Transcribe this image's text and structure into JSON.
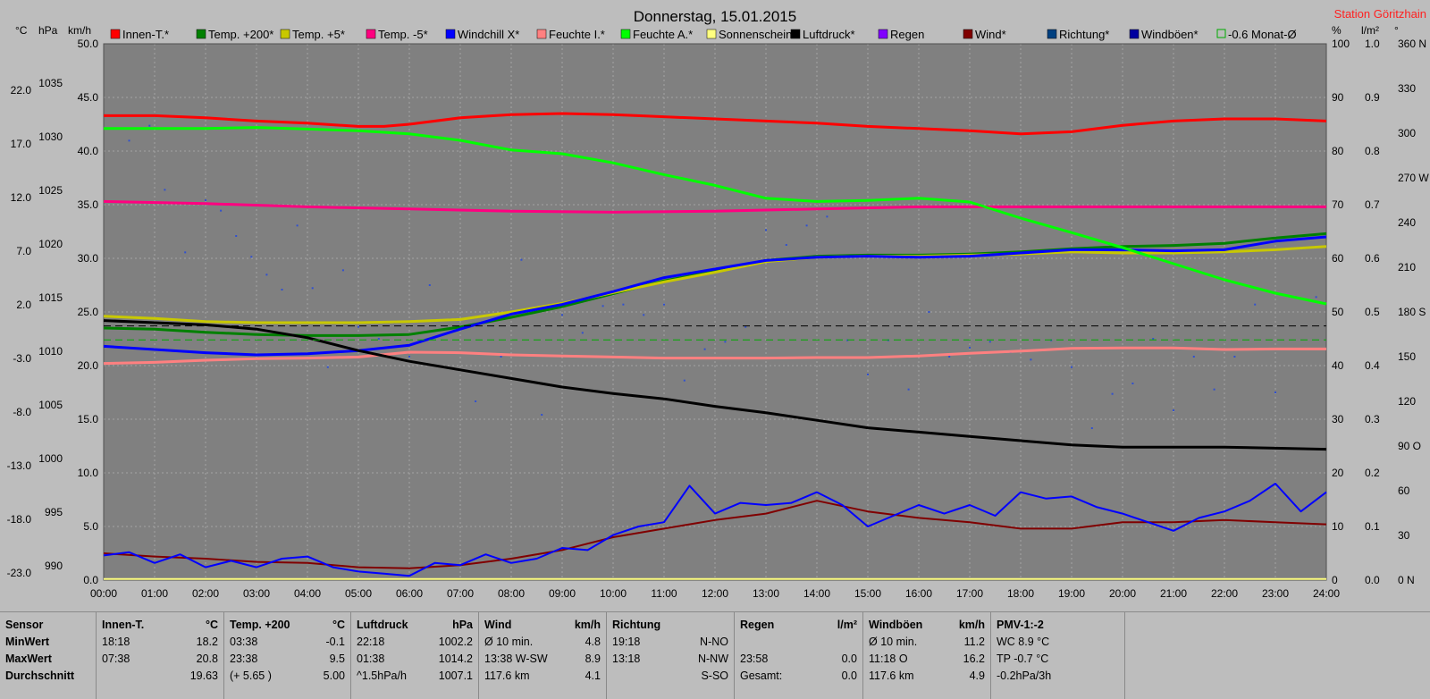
{
  "chart_data": {
    "type": "line",
    "title": "Donnerstag, 15.01.2015",
    "station": "Station Göritzhain",
    "left_axes": [
      {
        "unit": "°C",
        "ticks": [
          "22.0",
          "17.0",
          "12.0",
          "7.0",
          "2.0",
          "-3.0",
          "-8.0",
          "-13.0",
          "-18.0",
          "-23.0"
        ]
      },
      {
        "unit": "hPa",
        "ticks": [
          "1035",
          "1030",
          "1025",
          "1020",
          "1015",
          "1010",
          "1005",
          "1000",
          "995",
          "990"
        ]
      },
      {
        "unit": "km/h",
        "ticks": [
          "50.0",
          "45.0",
          "40.0",
          "35.0",
          "30.0",
          "25.0",
          "20.0",
          "15.0",
          "10.0",
          "5.0",
          "0.0"
        ]
      }
    ],
    "right_axes": [
      {
        "unit": "%",
        "ticks": [
          "100",
          "90",
          "80",
          "70",
          "60",
          "50",
          "40",
          "30",
          "20",
          "10",
          "0"
        ]
      },
      {
        "unit": "l/m²",
        "ticks": [
          "1.0",
          "0.9",
          "0.8",
          "0.7",
          "0.6",
          "0.5",
          "0.4",
          "0.3",
          "0.2",
          "0.1",
          "0.0"
        ]
      },
      {
        "unit": "°",
        "ticks": [
          "360 N",
          "330",
          "300",
          "270 W",
          "240",
          "210",
          "180 S",
          "150",
          "120",
          "90 O",
          "60",
          "30",
          "0 N"
        ]
      }
    ],
    "x_ticks": [
      "00:00",
      "01:00",
      "02:00",
      "03:00",
      "04:00",
      "05:00",
      "06:00",
      "07:00",
      "08:00",
      "09:00",
      "10:00",
      "11:00",
      "12:00",
      "13:00",
      "14:00",
      "15:00",
      "16:00",
      "17:00",
      "18:00",
      "19:00",
      "20:00",
      "21:00",
      "22:00",
      "23:00",
      "24:00"
    ],
    "legend": [
      {
        "name": "Innen-T.*",
        "color": "#ff0000"
      },
      {
        "name": "Temp. +200*",
        "color": "#008000"
      },
      {
        "name": "Temp. +5*",
        "color": "#c8c800"
      },
      {
        "name": "Temp. -5*",
        "color": "#ff0080"
      },
      {
        "name": "Windchill X*",
        "color": "#0000ff"
      },
      {
        "name": "Feuchte I.*",
        "color": "#ff8080"
      },
      {
        "name": "Feuchte A.*",
        "color": "#00ff00"
      },
      {
        "name": "Sonnenschein",
        "color": "#ffff80"
      },
      {
        "name": "Luftdruck*",
        "color": "#000000"
      },
      {
        "name": "Regen",
        "color": "#8000ff"
      },
      {
        "name": "Wind*",
        "color": "#800000"
      },
      {
        "name": "Richtung*",
        "color": "#004080"
      },
      {
        "name": "Windböen*",
        "color": "#0000a0"
      },
      {
        "name": "-0.6 Monat-Ø",
        "color": "#00aa00"
      }
    ],
    "series": [
      {
        "name": "Innen-T.*",
        "axis": "temp",
        "color": "#ff0000",
        "x": [
          0,
          1,
          2,
          3,
          4,
          5,
          5.5,
          6,
          7,
          8,
          9,
          10,
          11,
          12,
          13,
          14,
          15,
          16,
          17,
          18,
          19,
          20,
          21,
          22,
          23,
          24
        ],
        "y": [
          20.3,
          20.3,
          20.1,
          19.8,
          19.6,
          19.3,
          19.3,
          19.5,
          20.1,
          20.4,
          20.5,
          20.4,
          20.2,
          20.0,
          19.8,
          19.6,
          19.3,
          19.1,
          18.9,
          18.6,
          18.8,
          19.4,
          19.8,
          20.0,
          20.0,
          19.8
        ]
      },
      {
        "name": "Temp. +200*",
        "axis": "temp",
        "color": "#008000",
        "x": [
          0,
          1,
          2,
          3,
          4,
          5,
          6,
          7,
          8,
          9,
          10,
          11,
          12,
          13,
          14,
          15,
          16,
          17,
          18,
          19,
          20,
          21,
          22,
          23,
          24
        ],
        "y": [
          0.5,
          0.4,
          0.1,
          -0.1,
          -0.2,
          -0.2,
          -0.1,
          0.6,
          1.5,
          2.5,
          3.7,
          4.9,
          5.8,
          6.8,
          7.2,
          7.3,
          7.3,
          7.4,
          7.6,
          7.9,
          8.1,
          8.2,
          8.4,
          8.9,
          9.3
        ]
      },
      {
        "name": "Temp. +5*",
        "axis": "temp",
        "color": "#c8c800",
        "x": [
          0,
          1,
          2,
          3,
          4,
          5,
          6,
          7,
          8,
          9,
          10,
          11,
          12,
          13,
          14,
          15,
          16,
          17,
          18,
          19,
          20,
          21,
          22,
          23,
          24
        ],
        "y": [
          1.6,
          1.4,
          1.1,
          1.0,
          1.0,
          1.0,
          1.1,
          1.3,
          2.0,
          2.8,
          3.8,
          4.8,
          5.7,
          6.7,
          7.1,
          7.2,
          7.2,
          7.3,
          7.4,
          7.6,
          7.5,
          7.5,
          7.6,
          7.8,
          8.1
        ]
      },
      {
        "name": "Temp. -5*",
        "axis": "temp",
        "color": "#ff0080",
        "x": [
          0,
          2,
          4,
          6,
          8,
          10,
          12,
          14,
          16,
          18,
          20,
          22,
          24
        ],
        "y": [
          12.3,
          12.1,
          11.8,
          11.6,
          11.4,
          11.3,
          11.4,
          11.6,
          11.8,
          11.8,
          11.8,
          11.8,
          11.8
        ]
      },
      {
        "name": "Windchill X*",
        "axis": "temp",
        "color": "#0000ff",
        "x": [
          0,
          1,
          2,
          3,
          4,
          5,
          6,
          7,
          8,
          9,
          10,
          11,
          12,
          13,
          14,
          15,
          16,
          17,
          18,
          19,
          20,
          21,
          22,
          23,
          24
        ],
        "y": [
          -1.2,
          -1.5,
          -1.8,
          -2.0,
          -1.9,
          -1.6,
          -1.1,
          0.4,
          1.8,
          2.7,
          3.9,
          5.2,
          6.0,
          6.8,
          7.1,
          7.2,
          7.1,
          7.2,
          7.5,
          7.8,
          7.8,
          7.7,
          7.8,
          8.6,
          9.0
        ]
      },
      {
        "name": "Feuchte A.*",
        "axis": "pct",
        "color": "#00ff00",
        "x": [
          0,
          1,
          2,
          3,
          4,
          5,
          6,
          7,
          8,
          9,
          10,
          11,
          12,
          13,
          14,
          15,
          16,
          17,
          18,
          19,
          20,
          21,
          22,
          23,
          24
        ],
        "y": [
          84.2,
          84.2,
          84.2,
          84.4,
          84.1,
          83.8,
          83.2,
          82.0,
          80.2,
          79.5,
          77.8,
          75.6,
          73.6,
          71.2,
          70.6,
          70.8,
          71.2,
          70.5,
          67.5,
          64.8,
          62.0,
          59.0,
          56.0,
          53.5,
          51.5
        ]
      },
      {
        "name": "Feuchte I.*",
        "axis": "pct",
        "color": "#ff8080",
        "x": [
          0,
          1,
          2,
          3,
          4,
          5,
          6,
          7,
          8,
          9,
          10,
          11,
          12,
          13,
          14,
          15,
          16,
          17,
          18,
          19,
          20,
          21,
          22,
          23,
          24
        ],
        "y": [
          40.4,
          40.6,
          41.0,
          41.3,
          41.4,
          41.6,
          42.5,
          42.4,
          42.0,
          41.8,
          41.6,
          41.4,
          41.4,
          41.4,
          41.5,
          41.5,
          41.8,
          42.3,
          42.7,
          43.2,
          43.3,
          43.3,
          43.0,
          43.1,
          43.1
        ]
      },
      {
        "name": "Luftdruck*",
        "axis": "hpa",
        "color": "#000000",
        "x": [
          0,
          1,
          2,
          3,
          4,
          5,
          6,
          7,
          8,
          9,
          10,
          11,
          12,
          13,
          14,
          15,
          16,
          17,
          18,
          19,
          20,
          21,
          22,
          23,
          24
        ],
        "y": [
          1014.2,
          1014.0,
          1013.8,
          1013.4,
          1012.6,
          1011.4,
          1010.4,
          1009.6,
          1008.8,
          1008.0,
          1007.4,
          1006.9,
          1006.2,
          1005.6,
          1004.9,
          1004.2,
          1003.8,
          1003.4,
          1003.0,
          1002.6,
          1002.4,
          1002.4,
          1002.4,
          1002.3,
          1002.2
        ]
      },
      {
        "name": "Wind*",
        "axis": "kmh",
        "color": "#800000",
        "x": [
          0,
          1,
          2,
          3,
          4,
          5,
          6,
          7,
          8,
          9,
          10,
          11,
          12,
          13,
          14,
          15,
          16,
          17,
          18,
          19,
          20,
          21,
          22,
          23,
          24
        ],
        "y": [
          2.5,
          2.2,
          2.0,
          1.7,
          1.6,
          1.2,
          1.1,
          1.4,
          2.0,
          2.8,
          4.0,
          4.8,
          5.6,
          6.2,
          7.4,
          6.4,
          5.8,
          5.4,
          4.8,
          4.8,
          5.4,
          5.4,
          5.6,
          5.4,
          5.2
        ]
      },
      {
        "name": "Windböen*",
        "axis": "kmh",
        "color": "#0000ff",
        "x": [
          0,
          0.5,
          1,
          1.5,
          2,
          2.5,
          3,
          3.5,
          4,
          4.5,
          5,
          5.5,
          6,
          6.5,
          7,
          7.5,
          8,
          8.5,
          9,
          9.5,
          10,
          10.5,
          11,
          11.5,
          12,
          12.5,
          13,
          13.5,
          14,
          14.5,
          15,
          15.5,
          16,
          16.5,
          17,
          17.5,
          18,
          18.5,
          19,
          19.5,
          20,
          20.5,
          21,
          21.5,
          22,
          22.5,
          23,
          23.5,
          24
        ],
        "y": [
          2.3,
          2.6,
          1.6,
          2.4,
          1.2,
          1.8,
          1.2,
          2.0,
          2.2,
          1.2,
          0.8,
          0.6,
          0.4,
          1.6,
          1.4,
          2.4,
          1.6,
          2.0,
          3.0,
          2.8,
          4.2,
          5.0,
          5.4,
          8.8,
          6.2,
          7.2,
          7.0,
          7.2,
          8.2,
          7.0,
          5.0,
          6.0,
          7.0,
          6.2,
          7.0,
          6.0,
          8.2,
          7.6,
          7.8,
          6.8,
          6.2,
          5.4,
          4.6,
          5.8,
          6.4,
          7.4,
          9.0,
          6.4,
          8.2
        ]
      },
      {
        "name": "Sonnenschein",
        "axis": "kmh",
        "color": "#ffff80",
        "x": [
          0,
          24
        ],
        "y": [
          0.1,
          0.1
        ]
      },
      {
        "name": "-0.6 Monat-Ø",
        "axis": "temp",
        "color": "#00aa00",
        "dashed": true,
        "x": [
          0,
          24
        ],
        "y": [
          -0.6,
          -0.6
        ]
      },
      {
        "name": "ref",
        "axis": "temp",
        "color": "#000000",
        "dashed": true,
        "x": [
          0,
          24
        ],
        "y": [
          0.7,
          0.7
        ]
      }
    ],
    "direction_points": {
      "axis": "deg",
      "x": [
        0.5,
        0.9,
        1.2,
        1.6,
        2.0,
        2.3,
        2.6,
        2.9,
        3.2,
        3.5,
        3.8,
        4.1,
        4.4,
        4.7,
        5.0,
        5.4,
        5.7,
        6.0,
        6.4,
        6.8,
        7.3,
        7.8,
        8.2,
        8.6,
        9.0,
        9.4,
        9.8,
        10.2,
        10.6,
        11.0,
        11.4,
        11.8,
        12.2,
        12.6,
        13.0,
        13.4,
        13.8,
        14.2,
        14.6,
        15.0,
        15.4,
        15.8,
        16.2,
        16.6,
        17.0,
        17.4,
        17.8,
        18.2,
        18.6,
        19.0,
        19.4,
        19.8,
        20.2,
        20.6,
        21.0,
        21.4,
        21.8,
        22.2,
        22.6,
        23.0,
        23.4,
        23.8
      ],
      "y": [
        295,
        305,
        262,
        220,
        255,
        248,
        231,
        217,
        205,
        195,
        238,
        196,
        143,
        208,
        170,
        162,
        173,
        150,
        198,
        175,
        120,
        150,
        215,
        111,
        178,
        166,
        184,
        185,
        178,
        185,
        134,
        155,
        160,
        170,
        235,
        225,
        238,
        244,
        161,
        138,
        161,
        128,
        180,
        150,
        156,
        160,
        153,
        148,
        161,
        143,
        102,
        125,
        132,
        162,
        114,
        150,
        128,
        150,
        185,
        126,
        190,
        190
      ]
    }
  },
  "stats": {
    "col1": {
      "header": "Sensor",
      "rows": [
        "MinWert",
        "MaxWert",
        "Durchschnitt"
      ]
    },
    "col2": {
      "header": "Innen-T.",
      "unit": "°C",
      "rows": [
        [
          "18:18",
          "18.2"
        ],
        [
          "07:38",
          "20.8"
        ],
        [
          "",
          "19.63"
        ]
      ]
    },
    "col3": {
      "header": "Temp. +200",
      "unit": "°C",
      "rows": [
        [
          "03:38",
          "-0.1"
        ],
        [
          "23:38",
          "9.5"
        ],
        [
          "(+ 5.65 )",
          "5.00"
        ]
      ]
    },
    "col4": {
      "header": "Luftdruck",
      "unit": "hPa",
      "rows": [
        [
          "22:18",
          "1002.2"
        ],
        [
          "01:38",
          "1014.2"
        ],
        [
          "^1.5hPa/h",
          "1007.1"
        ]
      ]
    },
    "col5": {
      "header": "Wind",
      "unit": "km/h",
      "rows": [
        [
          "Ø 10 min.",
          "4.8"
        ],
        [
          "13:38     W-SW",
          "8.9"
        ],
        [
          "117.6 km",
          "4.1"
        ]
      ]
    },
    "col6": {
      "header": "Richtung",
      "unit": "",
      "rows": [
        [
          "19:18",
          "N-NO"
        ],
        [
          "13:18",
          "N-NW"
        ],
        [
          "",
          "S-SO"
        ]
      ]
    },
    "col7": {
      "header": "Regen",
      "unit": "l/m²",
      "rows": [
        [
          "",
          ""
        ],
        [
          "23:58",
          "0.0"
        ],
        [
          "Gesamt:",
          "0.0"
        ]
      ]
    },
    "col8": {
      "header": "Windböen",
      "unit": "km/h",
      "rows": [
        [
          "Ø 10 min.",
          "11.2"
        ],
        [
          "11:18      O",
          "16.2"
        ],
        [
          "117.6 km",
          "4.9"
        ]
      ]
    },
    "col9": {
      "header": "PMV-1:-2",
      "unit": "",
      "rows": [
        [
          "WC 8.9 °C",
          ""
        ],
        [
          "TP -0.7 °C",
          ""
        ],
        [
          "-0.2hPa/3h",
          ""
        ]
      ]
    }
  }
}
